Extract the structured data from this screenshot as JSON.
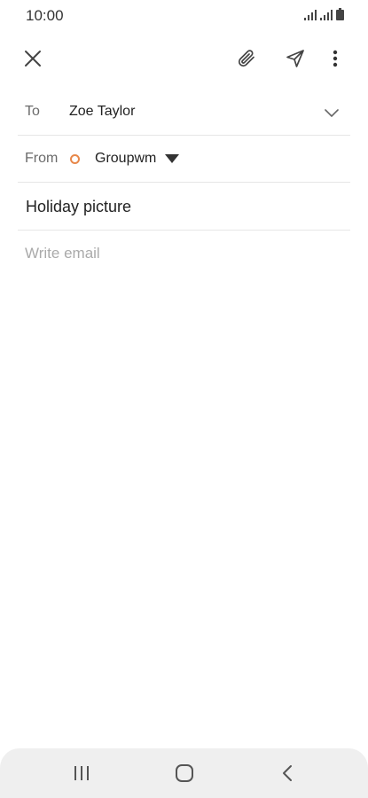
{
  "status_bar": {
    "time": "10:00",
    "icons": [
      "signal-icon",
      "signal-icon",
      "battery-icon"
    ]
  },
  "toolbar": {
    "icons": [
      "close-icon",
      "attach-icon",
      "send-icon",
      "more-vert-icon"
    ]
  },
  "compose": {
    "to_label": "To",
    "to_value": "Zoe Taylor",
    "from_label": "From",
    "from_value": "Groupwm",
    "subject_value": "Holiday picture",
    "body_placeholder": "Write email"
  },
  "colors": {
    "account_dot": "#e8884a",
    "divider": "#e6e6e6",
    "nav_bar": "#efefef"
  },
  "nav_bar": {
    "icons": [
      "recent-apps-icon",
      "home-icon",
      "back-icon"
    ]
  }
}
